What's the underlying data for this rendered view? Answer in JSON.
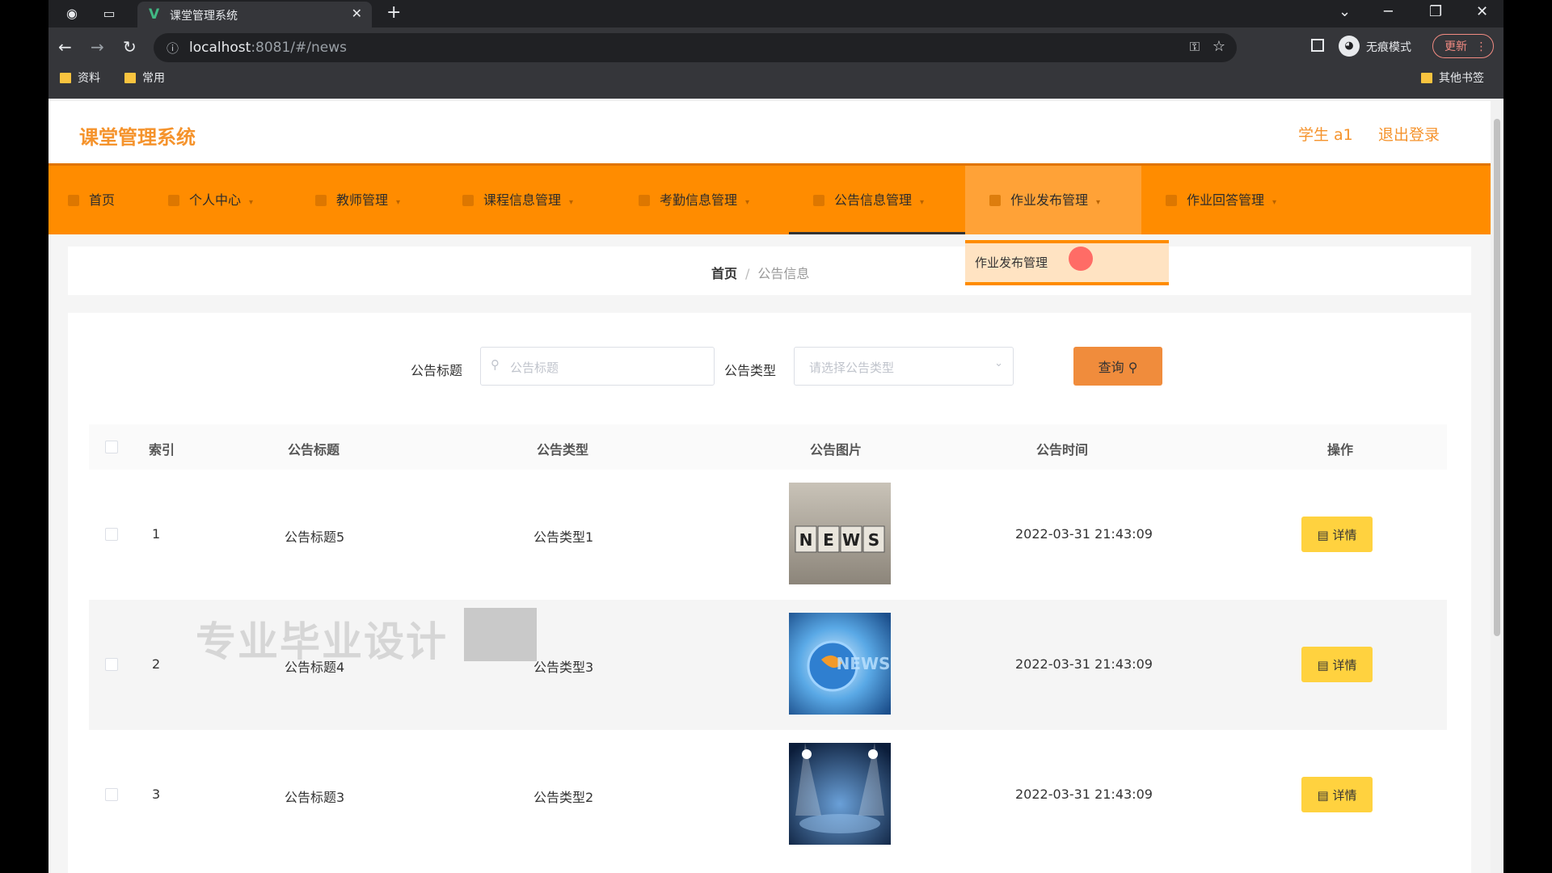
{
  "browser": {
    "tab_title": "课堂管理系统",
    "tab_close": "✕",
    "new_tab": "+",
    "url_host": "localhost",
    "url_rest": ":8081/#/news",
    "incognito_label": "无痕模式",
    "update_label": "更新",
    "bookmarks": [
      "资料",
      "常用"
    ],
    "other_bookmarks": "其他书签"
  },
  "header": {
    "logo": "课堂管理系统",
    "user": "学生 a1",
    "logout": "退出登录"
  },
  "menu": {
    "items": [
      "首页",
      "个人中心",
      "教师管理",
      "课程信息管理",
      "考勤信息管理",
      "公告信息管理",
      "作业发布管理",
      "作业回答管理"
    ],
    "active_index": 5,
    "hover_index": 6,
    "dropdown_item": "作业发布管理"
  },
  "breadcrumb": {
    "home": "首页",
    "separator": "/",
    "current": "公告信息"
  },
  "filters": {
    "title_label": "公告标题",
    "title_placeholder": "公告标题",
    "type_label": "公告类型",
    "type_placeholder": "请选择公告类型",
    "query_label": "查询"
  },
  "table": {
    "columns": [
      "索引",
      "公告标题",
      "公告类型",
      "公告图片",
      "公告时间",
      "操作"
    ],
    "rows": [
      {
        "index": "1",
        "title": "公告标题5",
        "type": "公告类型1",
        "image": "news-blocks",
        "time": "2022-03-31 21:43:09",
        "action": "详情"
      },
      {
        "index": "2",
        "title": "公告标题4",
        "type": "公告类型3",
        "image": "news-globe",
        "time": "2022-03-31 21:43:09",
        "action": "详情"
      },
      {
        "index": "3",
        "title": "公告标题3",
        "type": "公告类型2",
        "image": "news-stage",
        "time": "2022-03-31 21:43:09",
        "action": "详情"
      }
    ]
  },
  "watermark": "专业毕业设计",
  "colors": {
    "accent": "#ff8c00",
    "logo": "#f5932c",
    "detail_button": "#ffd23f",
    "query_button": "#f08c3c"
  }
}
